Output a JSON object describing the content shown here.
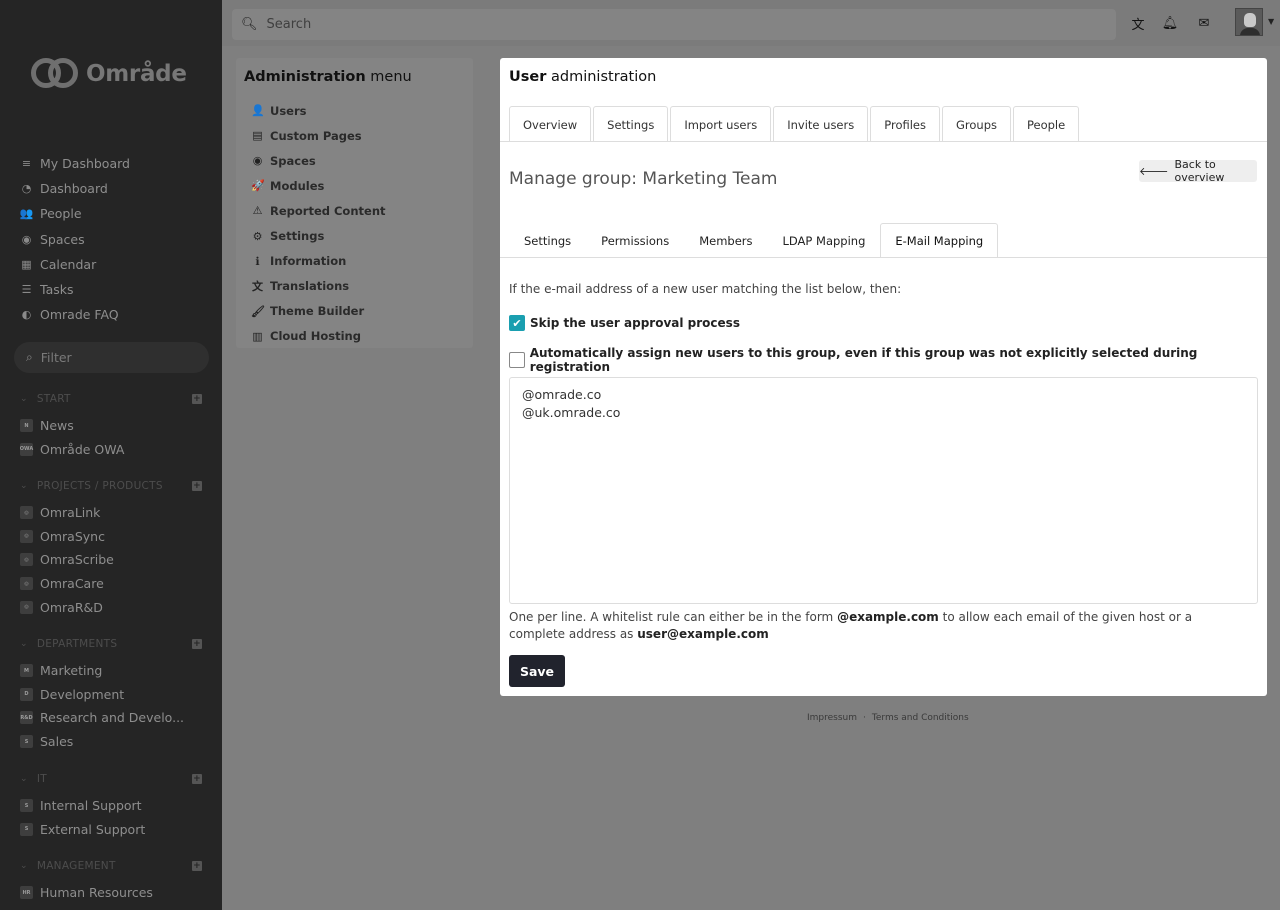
{
  "brand": {
    "name": "Område"
  },
  "main_nav": [
    {
      "label": "My Dashboard",
      "icon": "database-icon",
      "glyph": "≡"
    },
    {
      "label": "Dashboard",
      "icon": "tachometer-icon",
      "glyph": "◔"
    },
    {
      "label": "People",
      "icon": "users-icon",
      "glyph": "👥"
    },
    {
      "label": "Spaces",
      "icon": "dot-circle-icon",
      "glyph": "◉"
    },
    {
      "label": "Calendar",
      "icon": "calendar-icon",
      "glyph": "▦"
    },
    {
      "label": "Tasks",
      "icon": "tasks-icon",
      "glyph": "☰"
    },
    {
      "label": "Omrade FAQ",
      "icon": "adjust-icon",
      "glyph": "◐"
    }
  ],
  "filter": {
    "placeholder": "Filter"
  },
  "space_groups": [
    {
      "title": "START",
      "items": [
        {
          "label": "News",
          "badge": "N"
        },
        {
          "label": "Område OWA",
          "badge": "OWA"
        }
      ]
    },
    {
      "title": "PROJECTS / PRODUCTS",
      "items": [
        {
          "label": "OmraLink",
          "badge": "◎"
        },
        {
          "label": "OmraSync",
          "badge": "◎"
        },
        {
          "label": "OmraScribe",
          "badge": "◎"
        },
        {
          "label": "OmraCare",
          "badge": "◎"
        },
        {
          "label": "OmraR&D",
          "badge": "◎"
        }
      ]
    },
    {
      "title": "DEPARTMENTS",
      "items": [
        {
          "label": "Marketing",
          "badge": "M"
        },
        {
          "label": "Development",
          "badge": "D"
        },
        {
          "label": "Research and Develo...",
          "badge": "R&D"
        },
        {
          "label": "Sales",
          "badge": "S"
        }
      ]
    },
    {
      "title": "IT",
      "items": [
        {
          "label": "Internal Support",
          "badge": "S"
        },
        {
          "label": "External Support",
          "badge": "S"
        }
      ]
    },
    {
      "title": "MANAGEMENT",
      "items": [
        {
          "label": "Human Resources",
          "badge": "HR"
        }
      ]
    }
  ],
  "search": {
    "placeholder": "Search"
  },
  "admin_menu": {
    "title_bold": "Administration",
    "title_rest": " menu",
    "items": [
      {
        "label": "Users",
        "icon": "user-icon",
        "glyph": "👤"
      },
      {
        "label": "Custom Pages",
        "icon": "file-icon",
        "glyph": "▤"
      },
      {
        "label": "Spaces",
        "icon": "dot-circle-icon",
        "glyph": "◉"
      },
      {
        "label": "Modules",
        "icon": "rocket-icon",
        "glyph": "🚀"
      },
      {
        "label": "Reported Content",
        "icon": "warning-icon",
        "glyph": "⚠"
      },
      {
        "label": "Settings",
        "icon": "cogs-icon",
        "glyph": "⚙"
      },
      {
        "label": "Information",
        "icon": "info-icon",
        "glyph": "ℹ"
      },
      {
        "label": "Translations",
        "icon": "language-icon",
        "glyph": "文"
      },
      {
        "label": "Theme Builder",
        "icon": "paint-brush-icon",
        "glyph": "🖌"
      },
      {
        "label": "Cloud Hosting",
        "icon": "server-icon",
        "glyph": "▥"
      }
    ]
  },
  "panel": {
    "title_bold": "User",
    "title_rest": " administration",
    "tabs": [
      "Overview",
      "Settings",
      "Import users",
      "Invite users",
      "Profiles",
      "Groups",
      "People"
    ],
    "group_title": "Manage group: Marketing Team",
    "back_label": "Back to overview",
    "sub_tabs": [
      "Settings",
      "Permissions",
      "Members",
      "LDAP Mapping",
      "E-Mail Mapping"
    ],
    "active_sub_tab": "E-Mail Mapping",
    "intro": "If the e-mail address of a new user matching the list below, then:",
    "checkbox_skip": {
      "label": "Skip the user approval process",
      "checked": true
    },
    "checkbox_assign": {
      "label": "Automatically assign new users to this group, even if this group was not explicitly selected during registration",
      "checked": false
    },
    "whitelist": "@omrade.co\n@uk.omrade.co",
    "hint_pre": "One per line. A whitelist rule can either be in the form ",
    "hint_b1": "@example.com",
    "hint_mid": " to allow each email of the given host or a complete address as ",
    "hint_b2": "user@example.com",
    "save_label": "Save"
  },
  "footer": {
    "impressum": "Impressum",
    "sep": "·",
    "terms": "Terms and Conditions"
  },
  "colors": {
    "accent": "#1a9fb0",
    "save_button": "#21232d",
    "sidebar": "#252525"
  }
}
